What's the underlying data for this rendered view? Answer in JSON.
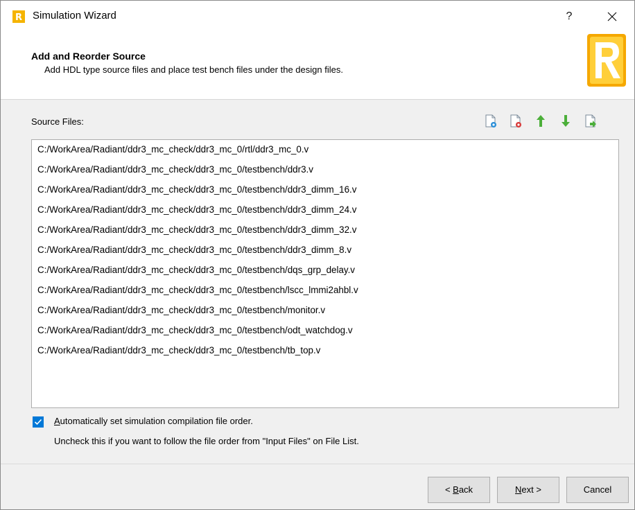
{
  "window": {
    "title": "Simulation Wizard",
    "help_label": "?"
  },
  "header": {
    "title": "Add and Reorder Source",
    "subtitle": "Add HDL type source files and place test bench files under the design files."
  },
  "source": {
    "label": "Source Files:",
    "files": [
      "C:/WorkArea/Radiant/ddr3_mc_check/ddr3_mc_0/rtl/ddr3_mc_0.v",
      "C:/WorkArea/Radiant/ddr3_mc_check/ddr3_mc_0/testbench/ddr3.v",
      "C:/WorkArea/Radiant/ddr3_mc_check/ddr3_mc_0/testbench/ddr3_dimm_16.v",
      "C:/WorkArea/Radiant/ddr3_mc_check/ddr3_mc_0/testbench/ddr3_dimm_24.v",
      "C:/WorkArea/Radiant/ddr3_mc_check/ddr3_mc_0/testbench/ddr3_dimm_32.v",
      "C:/WorkArea/Radiant/ddr3_mc_check/ddr3_mc_0/testbench/ddr3_dimm_8.v",
      "C:/WorkArea/Radiant/ddr3_mc_check/ddr3_mc_0/testbench/dqs_grp_delay.v",
      "C:/WorkArea/Radiant/ddr3_mc_check/ddr3_mc_0/testbench/lscc_lmmi2ahbl.v",
      "C:/WorkArea/Radiant/ddr3_mc_check/ddr3_mc_0/testbench/monitor.v",
      "C:/WorkArea/Radiant/ddr3_mc_check/ddr3_mc_0/testbench/odt_watchdog.v",
      "C:/WorkArea/Radiant/ddr3_mc_check/ddr3_mc_0/testbench/tb_top.v"
    ],
    "toolbar_icons": [
      "add-file-icon",
      "remove-file-icon",
      "move-up-icon",
      "move-down-icon",
      "export-file-icon"
    ]
  },
  "options": {
    "auto_order_checked": true,
    "auto_order_accel": "A",
    "auto_order_rest": "utomatically set simulation compilation file order.",
    "hint": "Uncheck this if you want to follow the file order from \"Input Files\" on File List."
  },
  "buttons": {
    "back_prefix": "< ",
    "back_accel": "B",
    "back_rest": "ack",
    "next_accel": "N",
    "next_rest": "ext >",
    "cancel": "Cancel"
  },
  "colors": {
    "accent": "#0078d7",
    "logo_orange": "#f5a800",
    "add_blue": "#2b8fd8",
    "remove_red": "#d83b3b",
    "arrow_green": "#4caf3a"
  }
}
